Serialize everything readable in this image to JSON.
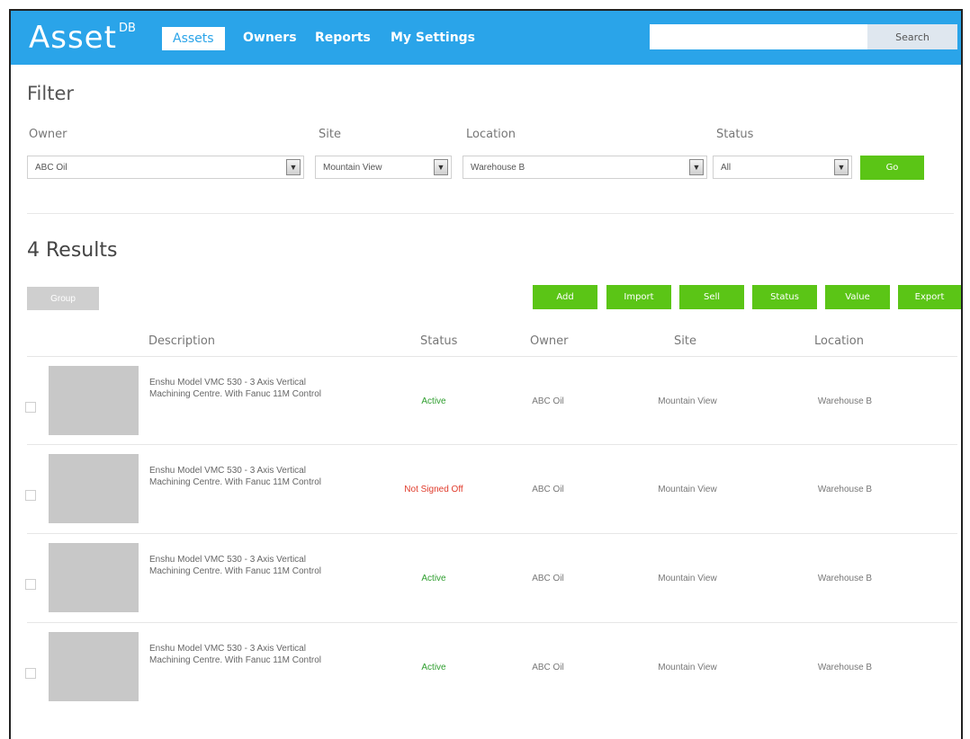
{
  "header": {
    "logo": "Asset",
    "logo_sup": "DB",
    "nav": [
      "Assets",
      "Owners",
      "Reports",
      "My Settings"
    ],
    "search_placeholder": "",
    "search_button": "Search"
  },
  "filter": {
    "title": "Filter",
    "owner_label": "Owner",
    "owner_value": "ABC Oil",
    "site_label": "Site",
    "site_value": "Mountain View",
    "location_label": "Location",
    "location_value": "Warehouse B",
    "status_label": "Status",
    "status_value": "All",
    "go_button": "Go"
  },
  "results": {
    "title": "4 Results",
    "group_button": "Group",
    "actions": [
      "Add",
      "Import",
      "Sell",
      "Status",
      "Value",
      "Export"
    ],
    "columns": [
      "Description",
      "Status",
      "Owner",
      "Site",
      "Location"
    ],
    "rows": [
      {
        "desc1": "Enshu Model VMC 530 - 3 Axis Vertical",
        "desc2": "Machining Centre. With Fanuc 11M Control",
        "status": "Active",
        "owner": "ABC Oil",
        "site": "Mountain View",
        "location": "Warehouse B"
      },
      {
        "desc1": "Enshu Model VMC 530 - 3 Axis Vertical",
        "desc2": "Machining Centre. With Fanuc 11M Control",
        "status": "Not Signed Off",
        "owner": "ABC Oil",
        "site": "Mountain View",
        "location": "Warehouse B"
      },
      {
        "desc1": "Enshu Model VMC 530 - 3 Axis Vertical",
        "desc2": "Machining Centre. With Fanuc 11M Control",
        "status": "Active",
        "owner": "ABC Oil",
        "site": "Mountain View",
        "location": "Warehouse B"
      },
      {
        "desc1": "Enshu Model VMC 530 - 3 Axis Vertical",
        "desc2": "Machining Centre. With Fanuc 11M Control",
        "status": "Active",
        "owner": "ABC Oil",
        "site": "Mountain View",
        "location": "Warehouse B"
      }
    ]
  },
  "colors": {
    "brand": "#2aa4e9",
    "button_green": "#5bc516",
    "status_active": "#2e9e2e",
    "status_not_signed_off": "#e03b2b"
  }
}
